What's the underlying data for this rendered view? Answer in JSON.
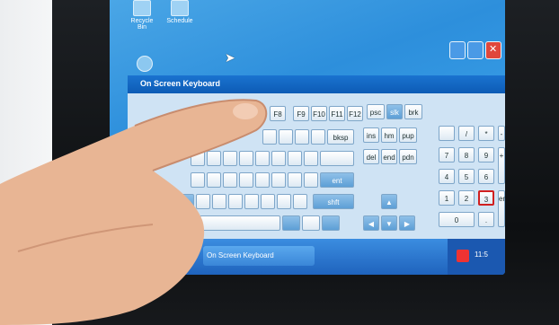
{
  "desktop": {
    "icons": [
      {
        "label": "Recycle Bin"
      },
      {
        "label": "Schedule"
      }
    ]
  },
  "window": {
    "title": "On Screen Keyboard"
  },
  "keyboard": {
    "function_keys": [
      "F8",
      "F9",
      "F10",
      "F11",
      "F12"
    ],
    "nav_keys": [
      "psc",
      "slk",
      "brk",
      "ins",
      "hm",
      "pup",
      "del",
      "end",
      "pdn"
    ],
    "edit_keys": [
      "bksp",
      "ent",
      "shft"
    ],
    "numpad": [
      "/",
      "*",
      "-",
      "7",
      "8",
      "9",
      "+",
      "4",
      "5",
      "6",
      "1",
      "2",
      "3",
      "ent",
      "0",
      "."
    ],
    "highlighted_keys": [
      "3"
    ]
  },
  "taskbar": {
    "task_label": "On Screen Keyboard",
    "clock": "11:5"
  }
}
